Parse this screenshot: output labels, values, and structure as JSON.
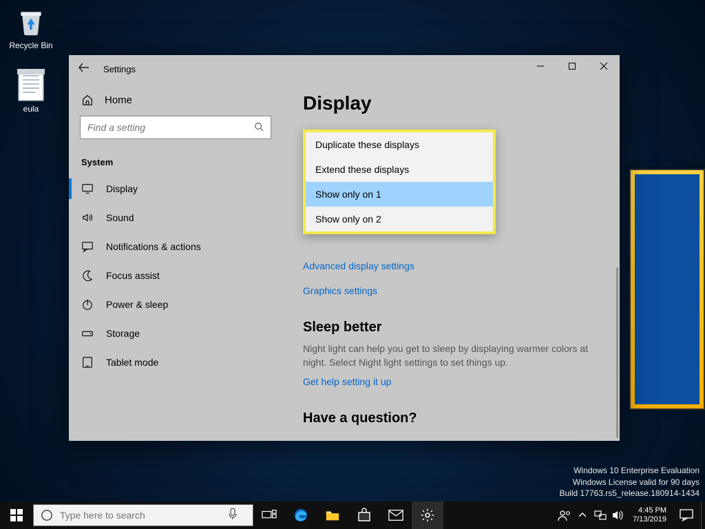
{
  "desktop": {
    "icons": [
      {
        "label": "Recycle Bin"
      },
      {
        "label": "eula"
      }
    ]
  },
  "watermark": {
    "line1": "Windows 10 Enterprise Evaluation",
    "line2": "Windows License valid for 90 days",
    "line3": "Build 17763.rs5_release.180914-1434"
  },
  "window": {
    "title": "Settings",
    "home_label": "Home",
    "search_placeholder": "Find a setting",
    "category": "System",
    "nav": [
      {
        "label": "Display",
        "icon": "monitor",
        "active": true
      },
      {
        "label": "Sound",
        "icon": "speaker"
      },
      {
        "label": "Notifications & actions",
        "icon": "chat"
      },
      {
        "label": "Focus assist",
        "icon": "moon"
      },
      {
        "label": "Power & sleep",
        "icon": "power"
      },
      {
        "label": "Storage",
        "icon": "drive"
      },
      {
        "label": "Tablet mode",
        "icon": "tablet"
      }
    ],
    "page": {
      "title": "Display",
      "dropdown": {
        "options": [
          "Duplicate these displays",
          "Extend these displays",
          "Show only on 1",
          "Show only on 2"
        ],
        "selected_index": 2
      },
      "link_advanced": "Advanced display settings",
      "link_graphics": "Graphics settings",
      "sleep_title": "Sleep better",
      "sleep_body": "Night light can help you get to sleep by displaying warmer colors at night. Select Night light settings to set things up.",
      "sleep_link": "Get help setting it up",
      "question_title": "Have a question?"
    }
  },
  "taskbar": {
    "search_placeholder": "Type here to search",
    "clock": {
      "time": "4:45 PM",
      "date": "7/13/2019"
    }
  }
}
